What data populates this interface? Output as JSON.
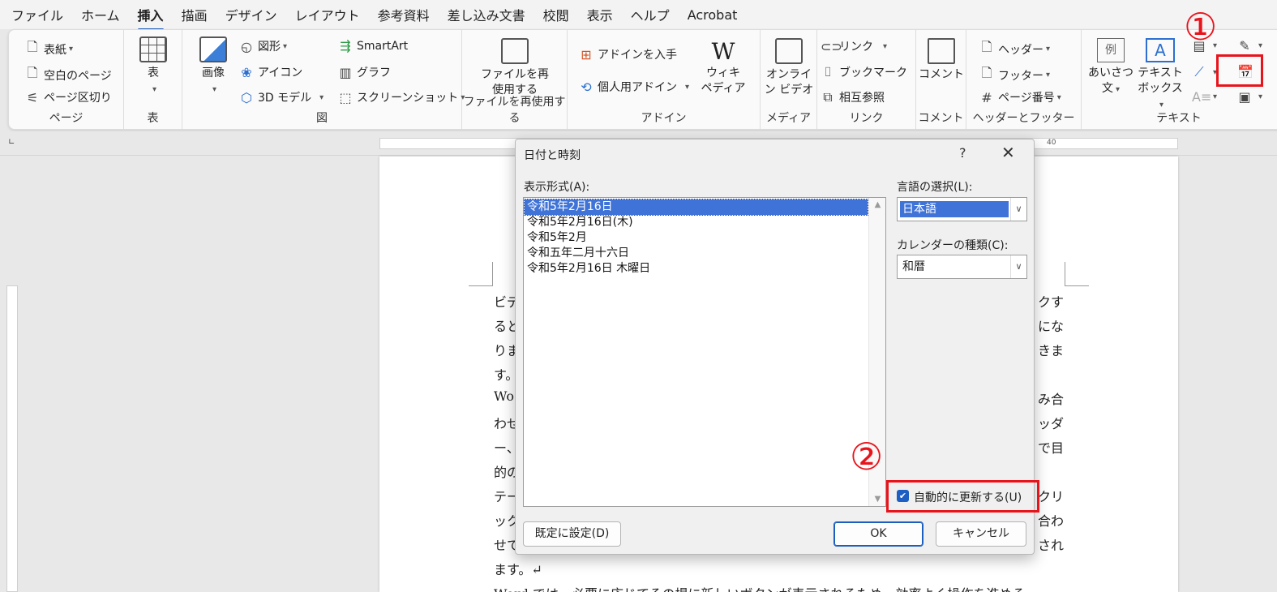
{
  "menu": {
    "items": [
      "ファイル",
      "ホーム",
      "挿入",
      "描画",
      "デザイン",
      "レイアウト",
      "参考資料",
      "差し込み文書",
      "校閲",
      "表示",
      "ヘルプ",
      "Acrobat"
    ],
    "active": "挿入"
  },
  "ribbon": {
    "page": {
      "group": "ページ",
      "cover": "表紙",
      "blank": "空白のページ",
      "break": "ページ区切り"
    },
    "table": {
      "group": "表",
      "table": "表"
    },
    "illust": {
      "group": "図",
      "image": "画像",
      "shapes": "図形",
      "icons": "アイコン",
      "model3d": "3D モデル",
      "smartart": "SmartArt",
      "chart": "グラフ",
      "screenshot": "スクリーンショット"
    },
    "reuse": {
      "group": "ファイルを再使用する",
      "button_line1": "ファイルを再",
      "button_line2": "使用する"
    },
    "addin": {
      "group": "アドイン",
      "get": "アドインを入手",
      "my": "個人用アドイン",
      "wiki_icon": "W",
      "wiki_line1": "ウィキ",
      "wiki_line2": "ペディア"
    },
    "media": {
      "group": "メディア",
      "video_line1": "オンライ",
      "video_line2": "ン ビデオ"
    },
    "links": {
      "group": "リンク",
      "link": "リンク",
      "bookmark": "ブックマーク",
      "crossref": "相互参照"
    },
    "comment": {
      "group": "コメント",
      "comment": "コメント"
    },
    "hf": {
      "group": "ヘッダーとフッター",
      "header": "ヘッダー",
      "footer": "フッター",
      "pagenum": "ページ番号"
    },
    "text": {
      "group": "テキスト",
      "greeting_icon": "例",
      "greeting_line1": "あいさつ",
      "greeting_line2": "文",
      "textbox_icon": "A",
      "textbox_line1": "テキスト",
      "textbox_line2": "ボックス"
    }
  },
  "ruler": {
    "mark": "40"
  },
  "document": {
    "lines": [
      {
        "left": "ビデ",
        "right": "クす"
      },
      {
        "left": "ると",
        "right": "にな"
      },
      {
        "left": "りま",
        "right": "きま"
      },
      {
        "left": "す。",
        "right": ""
      },
      {
        "left": "Wo",
        "right": "み合"
      },
      {
        "left": "わせ",
        "right": "ッダ"
      },
      {
        "left": "ー、",
        "right": "で目"
      },
      {
        "left": "的の",
        "right": ""
      },
      {
        "left": "テー",
        "right": "クリ"
      },
      {
        "left": "ック",
        "right": "合わ"
      },
      {
        "left": "せて",
        "right": "され"
      },
      {
        "left": "ます。↵",
        "right": ""
      },
      {
        "left": "Word では、必要に応じてその場に新しいボタンが表示されるため、効率よく操作を進める",
        "right": ""
      }
    ]
  },
  "dialog": {
    "title": "日付と時刻",
    "help": "?",
    "close": "✕",
    "format_label": "表示形式(A):",
    "formats": [
      "令和5年2月16日",
      "令和5年2月16日(木)",
      "令和5年2月",
      "令和五年二月十六日",
      "令和5年2月16日 木曜日"
    ],
    "selected_index": 0,
    "language_label": "言語の選択(L):",
    "language_value": "日本語",
    "calendar_label": "カレンダーの種類(C):",
    "calendar_value": "和暦",
    "auto_update_label": "自動的に更新する(U)",
    "auto_update_checked": true,
    "default_button": "既定に設定(D)",
    "ok_button": "OK",
    "cancel_button": "キャンセル"
  },
  "annotations": {
    "one": "①",
    "two": "②"
  },
  "colors": {
    "accent": "#1b5ebd",
    "selection": "#3f73d7",
    "callout": "#e8141c"
  }
}
